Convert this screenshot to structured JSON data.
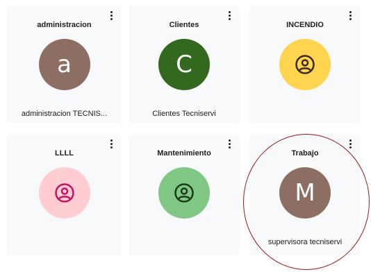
{
  "cards": [
    {
      "title": "administracion",
      "avatar_letter": "a",
      "avatar_color": "#8d6e63",
      "subtitle": "administracion TECNIS..."
    },
    {
      "title": "Clientes",
      "avatar_letter": "C",
      "avatar_color": "#33691e",
      "subtitle": "Clientes Tecniservi"
    },
    {
      "title": "INCENDIO",
      "avatar_icon": "account-circle-icon",
      "avatar_color": "#ffd54f",
      "icon_color": "#3e2723"
    },
    {
      "title": "LLLL",
      "avatar_icon": "account-circle-icon",
      "avatar_color": "#ffcdd2",
      "icon_color": "#c51162"
    },
    {
      "title": "Mantenimiento",
      "avatar_icon": "account-circle-icon",
      "avatar_color": "#81c784",
      "icon_color": "#1b3a1d"
    },
    {
      "title": "Trabajo",
      "avatar_letter": "M",
      "avatar_color": "#8d6e63",
      "subtitle": "supervisora tecniservi"
    }
  ],
  "highlight_color": "#a31515"
}
